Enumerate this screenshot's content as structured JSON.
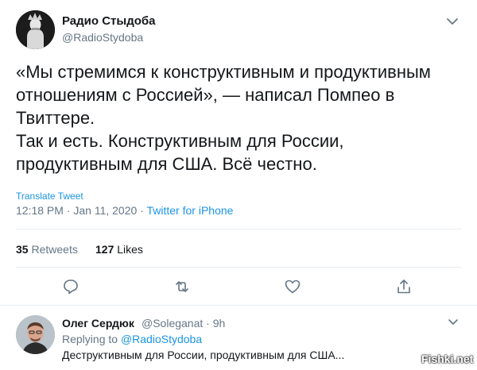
{
  "tweet": {
    "author_name": "Радио Стыдоба",
    "author_handle": "@RadioStydoba",
    "text_lines": [
      "«Мы стремимся к конструктивным и продуктивным",
      "отношениям с Россией», — написал Помпео в",
      "Твиттере.",
      "Так и есть. Конструктивным для России,",
      "продуктивным для США. Всё честно."
    ],
    "translate_label": "Translate Tweet",
    "time": "12:18 PM · Jan 11, 2020 · ",
    "source": "Twitter for iPhone",
    "retweets_count": "35",
    "retweets_label": "Retweets",
    "likes_count": "127",
    "likes_label": "Likes"
  },
  "actions": [
    "reply-icon",
    "retweet-icon",
    "like-icon",
    "share-icon"
  ],
  "reply": {
    "author_name": "Олег Сердюк",
    "author_handle": "@Soleganat · 9h",
    "replying_prefix": "Replying to ",
    "replying_to": "@RadioStydoba",
    "text": "Деструктивным для России, продуктивным для США..."
  },
  "watermark": "Fishki.net",
  "colors": {
    "link": "#1b95e0",
    "muted": "#657786",
    "text": "#14171a",
    "divider": "#e6ecf0"
  }
}
